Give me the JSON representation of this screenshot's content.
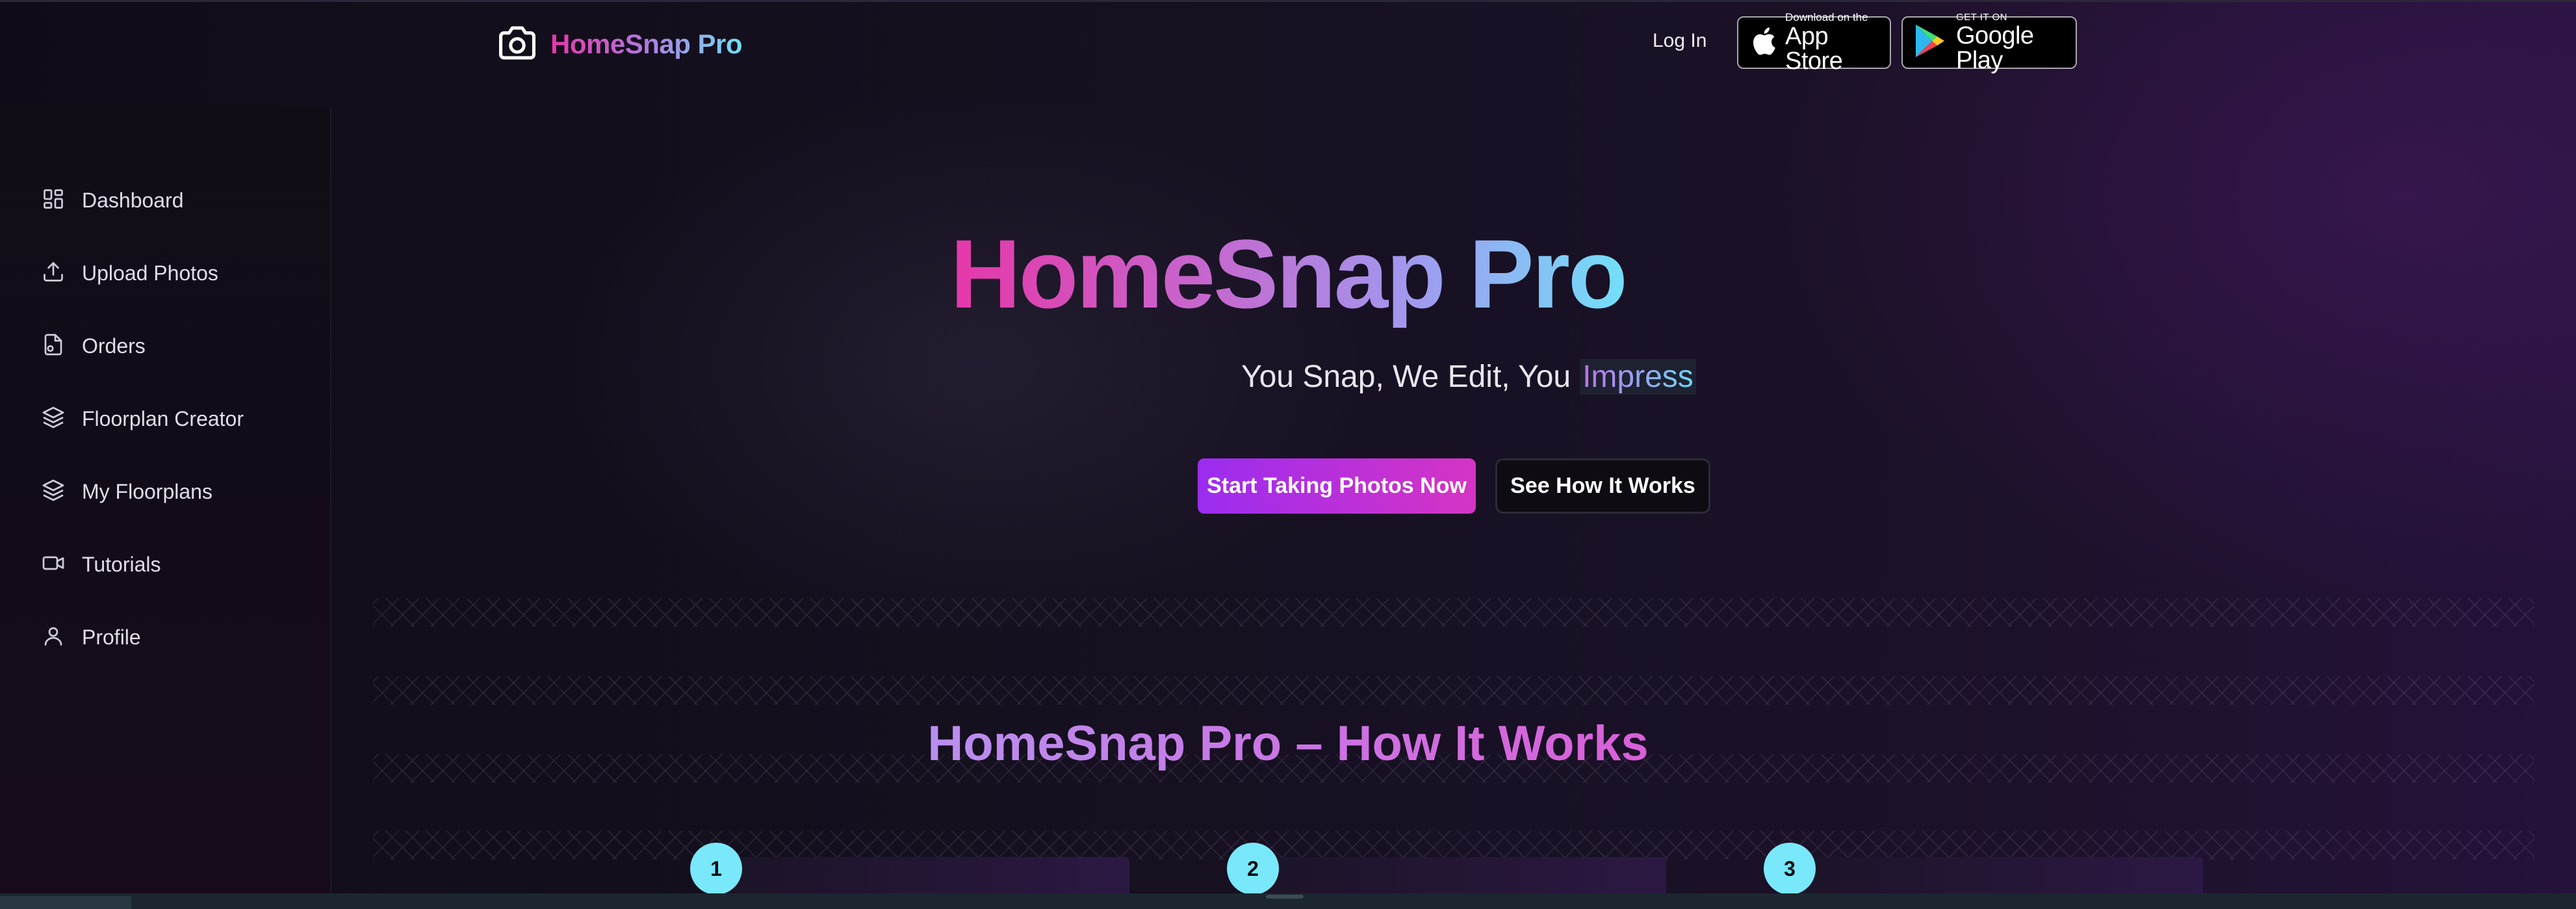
{
  "header": {
    "logo_text": "HomeSnap Pro",
    "login_label": "Log In",
    "app_store": {
      "small": "Download on the",
      "big": "App Store"
    },
    "google_play": {
      "small": "GET IT ON",
      "big": "Google Play"
    }
  },
  "sidebar": {
    "items": [
      {
        "label": "Dashboard",
        "icon": "dashboard-icon"
      },
      {
        "label": "Upload Photos",
        "icon": "upload-icon"
      },
      {
        "label": "Orders",
        "icon": "orders-icon"
      },
      {
        "label": "Floorplan Creator",
        "icon": "layers-icon"
      },
      {
        "label": "My Floorplans",
        "icon": "layers-icon"
      },
      {
        "label": "Tutorials",
        "icon": "video-icon"
      },
      {
        "label": "Profile",
        "icon": "user-icon"
      }
    ]
  },
  "hero": {
    "title": "HomeSnap Pro",
    "tagline_prefix": "You Snap, We Edit, You",
    "tagline_highlight": "Impress",
    "primary_cta": "Start Taking Photos Now",
    "secondary_cta": "See How It Works"
  },
  "how_it_works": {
    "title": "HomeSnap Pro – How It Works",
    "steps": [
      "1",
      "2",
      "3"
    ]
  },
  "colors": {
    "brand_pink": "#e637a8",
    "brand_cyan": "#72e0f8",
    "cta_purple": "#9b2cf0",
    "cta_magenta": "#d634c4",
    "step_badge": "#79e8fa"
  }
}
